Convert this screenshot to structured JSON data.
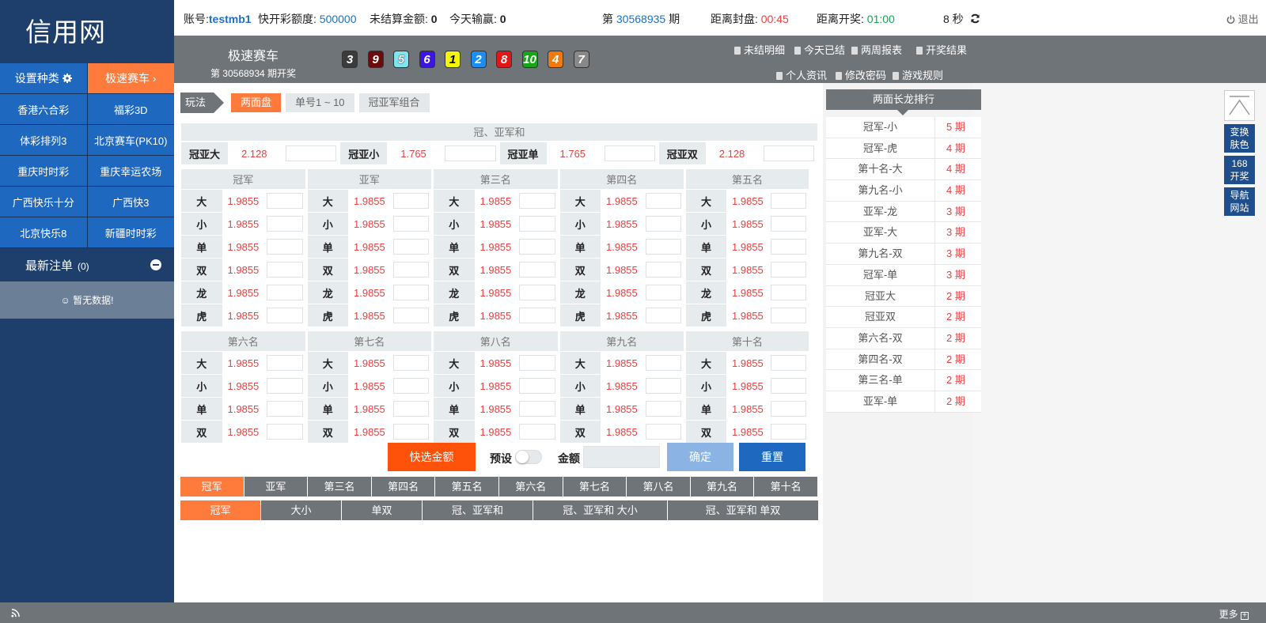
{
  "logo": "信用网",
  "left": {
    "set_label": "设置种类",
    "current_label": "极速赛车 ›",
    "games": [
      [
        "香港六合彩",
        "福彩3D"
      ],
      [
        "体彩排列3",
        "北京赛车(PK10)"
      ],
      [
        "重庆时时彩",
        "重庆幸运农场"
      ],
      [
        "广西快乐十分",
        "广西快3"
      ],
      [
        "北京快乐8",
        "新疆时时彩"
      ]
    ],
    "recent_label": "最新注单",
    "recent_count": "(0)",
    "nodata": "☺ 暂无数据!"
  },
  "top": {
    "account_label": "账号:",
    "account": "testmb1",
    "quota_label": "快开彩额度:",
    "quota": "500000",
    "unsettled_label": "未结算金额:",
    "unsettled": "0",
    "today_label": "今天输赢:",
    "today": "0",
    "issue_pre": "第",
    "issue": "30568935",
    "issue_post": "期",
    "close_label": "距离封盘:",
    "close_time": "00:45",
    "open_label": "距离开奖:",
    "open_time": "01:00",
    "countdown": "8 秒",
    "logout": "退出"
  },
  "header": {
    "game": "极速赛车",
    "period": "第 30568934 期开奖",
    "balls": [
      "3",
      "9",
      "5",
      "6",
      "1",
      "2",
      "8",
      "10",
      "4",
      "7"
    ],
    "ball_colors": [
      "#3b3b3b",
      "#6b0b0b",
      "#7fe5ee",
      "#3a16e0",
      "#f6f600",
      "#1d8ef0",
      "#e21616",
      "#17a617",
      "#ee7b10",
      "#888888"
    ],
    "links": [
      "未结明细",
      "今天已结",
      "两周报表",
      "开奖结果",
      "个人资讯",
      "修改密码",
      "游戏规则"
    ]
  },
  "tabs": {
    "wanfa": "玩法",
    "items": [
      "两面盘",
      "单号1 ~ 10",
      "冠亚军组合"
    ]
  },
  "sum": {
    "title": "冠、亚军和",
    "items": [
      {
        "label": "冠亚大",
        "odds": "2.128"
      },
      {
        "label": "冠亚小",
        "odds": "1.765"
      },
      {
        "label": "冠亚单",
        "odds": "1.765"
      },
      {
        "label": "冠亚双",
        "odds": "2.128"
      }
    ]
  },
  "block1": {
    "columns": [
      "冠军",
      "亚军",
      "第三名",
      "第四名",
      "第五名"
    ],
    "rows": [
      "大",
      "小",
      "单",
      "双",
      "龙",
      "虎"
    ],
    "odds": "1.9855"
  },
  "block2": {
    "columns": [
      "第六名",
      "第七名",
      "第八名",
      "第九名",
      "第十名"
    ],
    "rows": [
      "大",
      "小",
      "单",
      "双"
    ],
    "odds": "1.9855"
  },
  "actions": {
    "quick": "快选金额",
    "preset": "预设",
    "amount": "金额",
    "confirm": "确定",
    "reset": "重置"
  },
  "bottom1": [
    "冠军",
    "亚军",
    "第三名",
    "第四名",
    "第五名",
    "第六名",
    "第七名",
    "第八名",
    "第九名",
    "第十名"
  ],
  "bottom2": [
    "冠军",
    "大小",
    "单双",
    "冠、亚军和",
    "冠、亚军和 大小",
    "冠、亚军和 单双"
  ],
  "rank": {
    "title": "两面长龙排行",
    "items": [
      [
        "冠军-小",
        "5 期"
      ],
      [
        "冠军-虎",
        "4 期"
      ],
      [
        "第十名-大",
        "4 期"
      ],
      [
        "第九名-小",
        "4 期"
      ],
      [
        "亚军-龙",
        "3 期"
      ],
      [
        "亚军-大",
        "3 期"
      ],
      [
        "第九名-双",
        "3 期"
      ],
      [
        "冠军-单",
        "3 期"
      ],
      [
        "冠亚大",
        "2 期"
      ],
      [
        "冠亚双",
        "2 期"
      ],
      [
        "第六名-双",
        "2 期"
      ],
      [
        "第四名-双",
        "2 期"
      ],
      [
        "第三名-单",
        "2 期"
      ],
      [
        "亚军-单",
        "2 期"
      ]
    ]
  },
  "side": [
    "变换肤色",
    "168开奖",
    "导航网站"
  ],
  "footer": {
    "more": "更多"
  }
}
